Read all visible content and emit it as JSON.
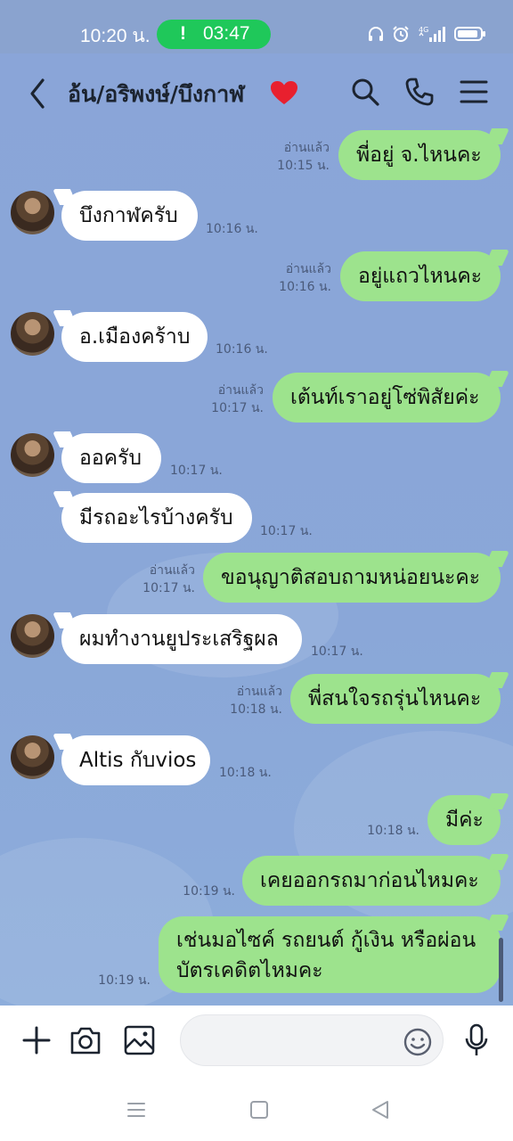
{
  "status_bar": {
    "time": "10:20 น.",
    "call_duration": "03:47",
    "call_indicator": "!",
    "icons": [
      "headphones-icon",
      "alarm-icon",
      "signal-4g-icon",
      "battery-icon"
    ]
  },
  "header": {
    "title": "อ้น/อริพงษ์/บึงกาฬ",
    "icons": [
      "back-icon",
      "heart-icon",
      "search-icon",
      "phone-icon",
      "menu-icon"
    ]
  },
  "messages": [
    {
      "side": "out",
      "text": "พี่อยู่ จ.ไหนคะ",
      "read": "อ่านแล้ว",
      "time": "10:15 น."
    },
    {
      "side": "in",
      "text": "บึงกาฬครับ",
      "time": "10:16 น."
    },
    {
      "side": "out",
      "text": "อยู่แถวไหนคะ",
      "read": "อ่านแล้ว",
      "time": "10:16 น."
    },
    {
      "side": "in",
      "text": "อ.เมืองคร้าบ",
      "time": "10:16 น."
    },
    {
      "side": "out",
      "text": "เต้นท์เราอยู่โซ่พิสัยค่ะ",
      "read": "อ่านแล้ว",
      "time": "10:17 น."
    },
    {
      "side": "in",
      "text": "ออครับ",
      "time": "10:17 น."
    },
    {
      "side": "in",
      "text": "มีรถอะไรบ้างครับ",
      "time": "10:17 น."
    },
    {
      "side": "out",
      "text": "ขอนุญาติสอบถามหน่อยนะคะ",
      "read": "อ่านแล้ว",
      "time": "10:17 น."
    },
    {
      "side": "in",
      "text": "ผมทำงานยูประเสริฐผล",
      "time": "10:17 น."
    },
    {
      "side": "out",
      "text": "พี่สนใจรถรุ่นไหนคะ",
      "read": "อ่านแล้ว",
      "time": "10:18 น."
    },
    {
      "side": "in",
      "text": "Altis กับvios",
      "time": "10:18 น."
    },
    {
      "side": "out",
      "text": "มีค่ะ",
      "time": "10:18 น."
    },
    {
      "side": "out",
      "text": "เคยออกรถมาก่อนไหมคะ",
      "time": "10:19 น."
    },
    {
      "side": "out",
      "text_line1": "เช่นมอไซค์ รถยนต์ กู้เงิน หรือผ่อน",
      "text_line2": "บัตรเคดิตไหมคะ",
      "time": "10:19 น."
    }
  ],
  "input_bar": {
    "placeholder": "",
    "icons": [
      "plus-icon",
      "camera-icon",
      "image-icon",
      "emoji-icon",
      "microphone-icon"
    ]
  },
  "nav_bar": {
    "icons": [
      "recent-apps-icon",
      "home-icon",
      "back-nav-icon"
    ]
  },
  "colors": {
    "chat_background": "#8aa7d8",
    "outgoing_bubble": "#9de38d",
    "incoming_bubble": "#ffffff",
    "call_pill": "#1fc85a",
    "heart": "#e8202e"
  }
}
